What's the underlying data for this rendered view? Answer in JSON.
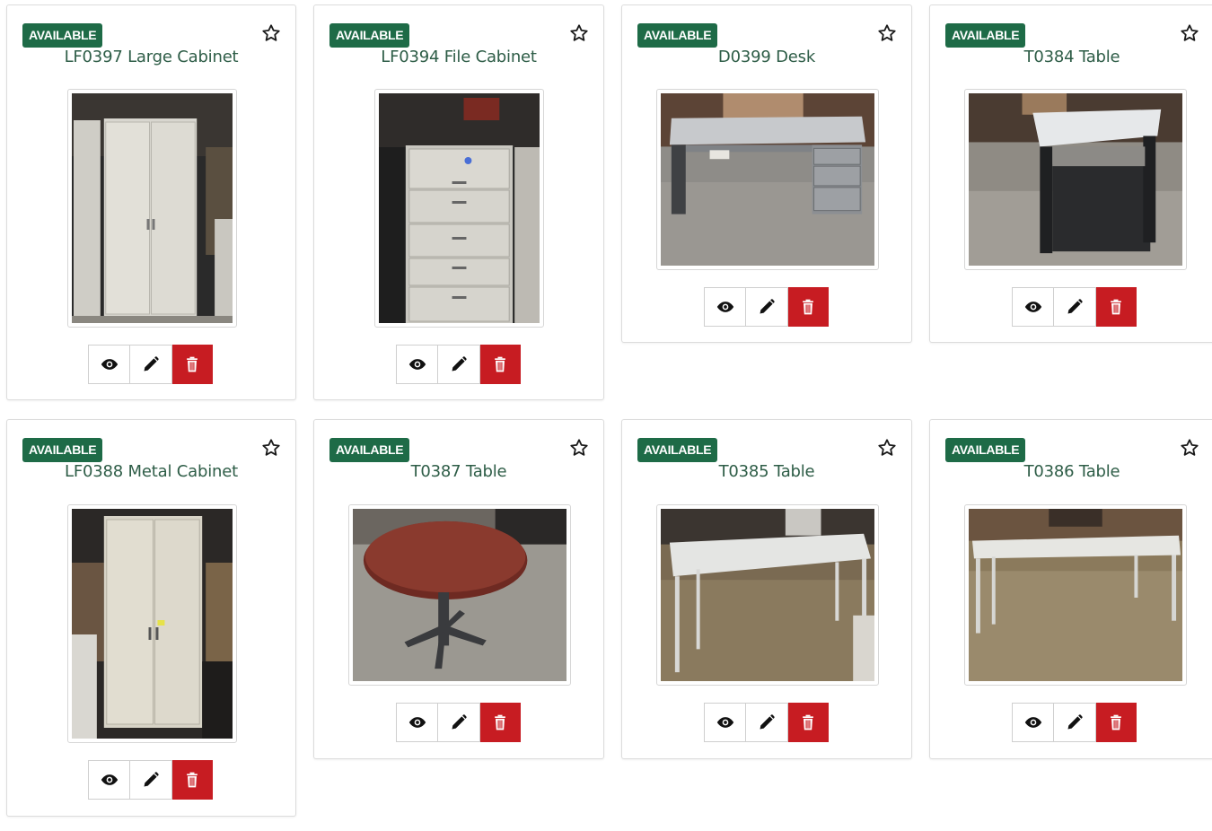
{
  "colors": {
    "badge": "#1e6b47",
    "title": "#2e5d47",
    "delete": "#c71c22"
  },
  "icons": {
    "favorite": "star-outline-icon",
    "view": "eye-icon",
    "edit": "pencil-icon",
    "delete": "trash-icon"
  },
  "items": [
    {
      "status": "AVAILABLE",
      "title": "LF0397 Large Cabinet",
      "photo": "tall-cabinet"
    },
    {
      "status": "AVAILABLE",
      "title": "LF0394 File Cabinet",
      "photo": "file-cabinet"
    },
    {
      "status": "AVAILABLE",
      "title": "D0399 Desk",
      "photo": "desk"
    },
    {
      "status": "AVAILABLE",
      "title": "T0384 Table",
      "photo": "standing-table"
    },
    {
      "status": "AVAILABLE",
      "title": "LF0388 Metal Cabinet",
      "photo": "tall-cabinet"
    },
    {
      "status": "AVAILABLE",
      "title": "T0387 Table",
      "photo": "round-table"
    },
    {
      "status": "AVAILABLE",
      "title": "T0385 Table",
      "photo": "long-table"
    },
    {
      "status": "AVAILABLE",
      "title": "T0386 Table",
      "photo": "long-table"
    }
  ]
}
